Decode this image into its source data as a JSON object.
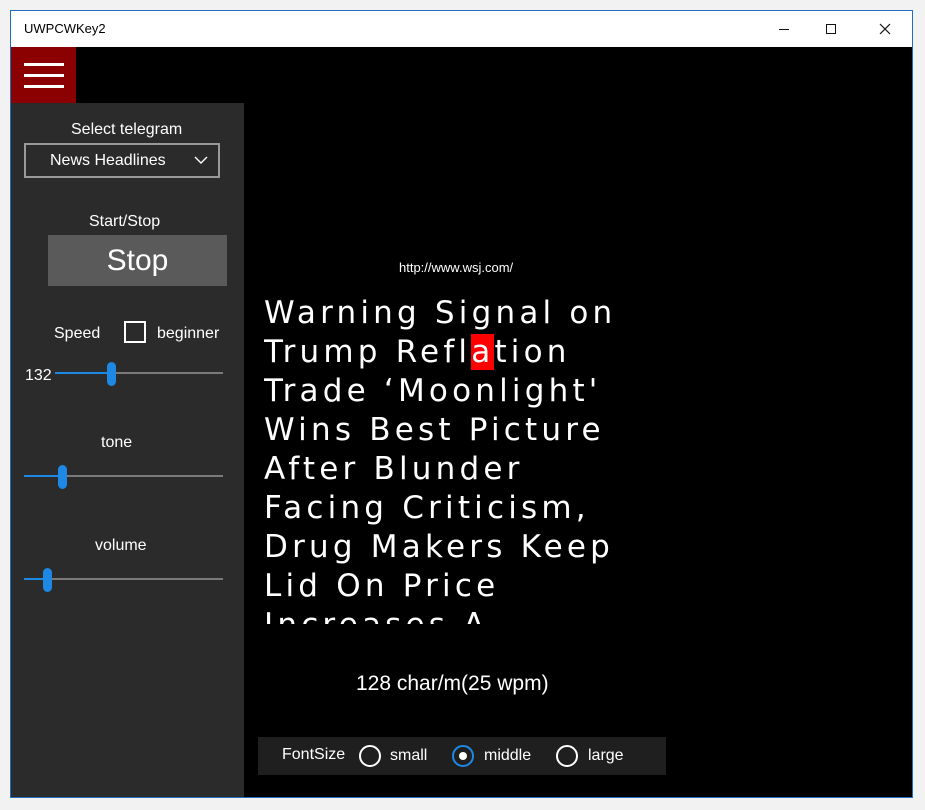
{
  "window": {
    "title": "UWPCWKey2"
  },
  "sidebar": {
    "select_label": "Select telegram",
    "telegram_selected": "News Headlines",
    "start_stop_label": "Start/Stop",
    "stop_button": "Stop",
    "speed_label": "Speed",
    "beginner_label": "beginner",
    "beginner_checked": false,
    "speed_value": "132",
    "speed_level": 0.33,
    "tone_label": "tone",
    "tone_level": 0.18,
    "volume_label": "volume",
    "volume_level": 0.1
  },
  "main": {
    "source_url": "http://www.wsj.com/",
    "headline_lines": [
      {
        "pre": "Warning Signal on",
        "hl": "",
        "post": ""
      },
      {
        "pre": "Trump Refl",
        "hl": "a",
        "post": "tion"
      },
      {
        "pre": "Trade ‘Moonlight'",
        "hl": "",
        "post": ""
      },
      {
        "pre": "Wins Best Picture",
        "hl": "",
        "post": ""
      },
      {
        "pre": "After Blunder",
        "hl": "",
        "post": ""
      },
      {
        "pre": "Facing Criticism,",
        "hl": "",
        "post": ""
      },
      {
        "pre": "Drug Makers Keep",
        "hl": "",
        "post": ""
      },
      {
        "pre": "Lid On Price",
        "hl": "",
        "post": ""
      },
      {
        "pre": "Increases A",
        "hl": "",
        "post": ""
      }
    ],
    "speed_readout": "128 char/m(25 wpm)",
    "fontsize": {
      "label": "FontSize",
      "options": [
        "small",
        "middle",
        "large"
      ],
      "selected": "middle"
    }
  },
  "icons": {
    "menu": "hamburger-icon",
    "more": "more-icon",
    "dropdown": "chevron-down-icon"
  },
  "colors": {
    "accent": "#1e88e5",
    "hamburger_bg": "#8b0000",
    "highlight": "#ff0000"
  }
}
